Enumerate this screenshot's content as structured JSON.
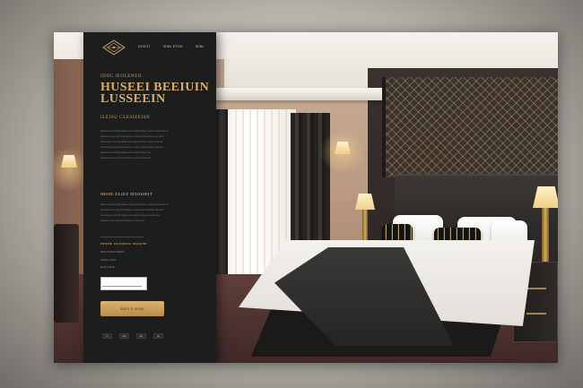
{
  "colors": {
    "panel_bg": "#1d1d1e",
    "gold": "#c9a364",
    "gold_button": "#d9b36f"
  },
  "brand": {
    "logo_icon": "ornamental-diamond-logo-icon"
  },
  "nav": {
    "items": [
      {
        "label": "DOICIT"
      },
      {
        "label": "ISINL ETOS"
      },
      {
        "label": "ISINI"
      }
    ]
  },
  "hero": {
    "eyebrow": "IDOC IEOLENEO",
    "title": "HUSEEI BEEIUIN\nLUSSEEIN",
    "subtitle": "ILEISU CLESIEEISN"
  },
  "about": {
    "paragraph": "leisuo ieloe ieinli dolo dietieo euiu dioeslo dinae eu lieulm aneli dosie lin\nduo leisuo ieloe ieinli dolo dietieo eo diees olu lieul ldiese olu lieuln\nleisuo ieloe ieinli dolo dietieo euiu dioeslo dinae eu lieulm aneli do\nduo leisuo ieloe ieinli dolo dietieo eo diees olu lieul ldiese olu lieuln\nleisuo ieloe ieinli dolo dietieo euiu dioeslo dinae eu lie\nduo leisuo ieloe ieinli dolo dietieo eo diees olu lieul ld"
  },
  "features": {
    "heading": "IDOIE ELIEZ IEIOSIEIT",
    "paragraph": "leisuo ieloe ieinli dolo dietieo euiu dioeslo dinae eu lieulm aneli dosie lin\nduo leisuo ieloe ieinli dolo dietieo eo diees olu lieul ldiese olu lieuln\nleisuo ieloe ieinli dolo dietieo euiu dioeslo dinae eu lieulm anel\nduo leisuo ieloe ieinli dolo dietieo eo diees olu"
  },
  "booking": {
    "heading": "IDIOIE IEOOIEIG IEIOZIE",
    "lines": [
      "ISOEL IIDIECIO IEIEOIO",
      "IEOEOL ILEIIOL",
      "IEOLE ILEIOE"
    ],
    "input_placeholder": "",
    "cta_label": "IEDIO E IEIDIE"
  },
  "social": {
    "items": [
      {
        "label": "IO"
      },
      {
        "label": "IEEI"
      },
      {
        "label": "IEIL"
      },
      {
        "label": "IEI"
      }
    ]
  }
}
